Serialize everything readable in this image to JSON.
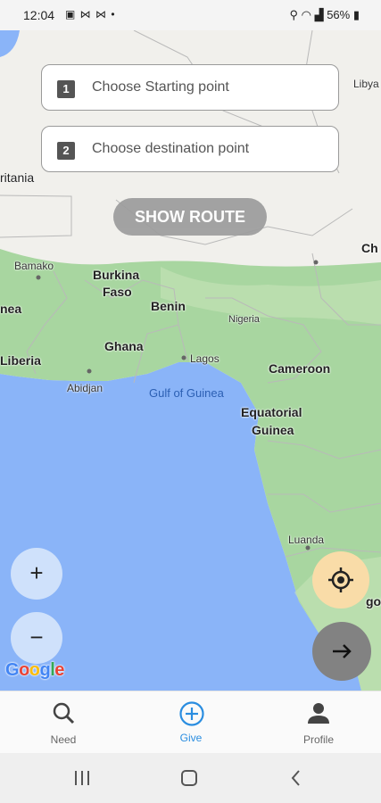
{
  "status_bar": {
    "time": "12:04",
    "left_icons": "▣ ⋈ ⋈ •",
    "right_text": "56%"
  },
  "inputs": {
    "start": {
      "number": "1",
      "placeholder": "Choose Starting point"
    },
    "destination": {
      "number": "2",
      "placeholder": "Choose destination point"
    }
  },
  "show_route_label": "SHOW ROUTE",
  "map_labels": {
    "libya": "Libya",
    "mauritania": "ritania",
    "chad": "Ch",
    "bamako": "Bamako",
    "burkina": "Burkina",
    "faso": "Faso",
    "benin": "Benin",
    "nigeria": "Nigeria",
    "guinea": "nea",
    "ghana": "Ghana",
    "lagos": "Lagos",
    "liberia": "Liberia",
    "abidjan": "Abidjan",
    "gulf": "Gulf of Guinea",
    "cameroon": "Cameroon",
    "eq1": "Equatorial",
    "eq2": "Guinea",
    "luanda": "Luanda",
    "gola": "gol"
  },
  "zoom": {
    "in": "+",
    "out": "−"
  },
  "google_logo": "Google",
  "bottom_nav": {
    "need": "Need",
    "give": "Give",
    "profile": "Profile"
  },
  "colors": {
    "land": "#f1f0ec",
    "vegetation": "#a8d6a0",
    "water": "#8ab4f8",
    "accent": "#2a8de0",
    "location_fab": "#f9dca8"
  }
}
